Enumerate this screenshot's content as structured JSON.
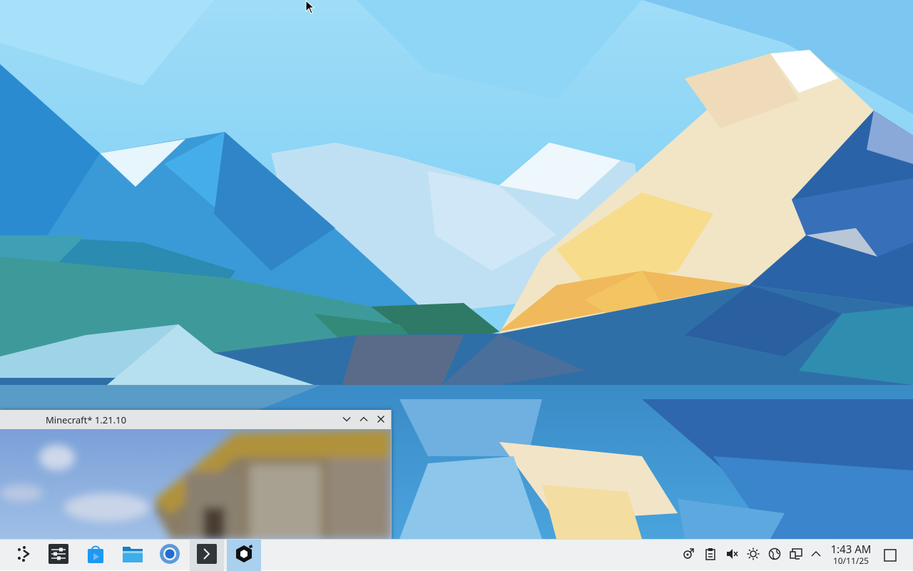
{
  "window": {
    "title": "Minecraft* 1.21.10",
    "minimize_icon": "chevron-down-icon",
    "maximize_icon": "chevron-up-icon",
    "close_icon": "close-icon"
  },
  "taskbar": {
    "launcher_icon": "application-launcher-icon",
    "pinned": [
      {
        "name": "system-settings",
        "icon": "settings-sliders-icon"
      },
      {
        "name": "discover",
        "icon": "store-bag-icon"
      },
      {
        "name": "dolphin",
        "icon": "folder-icon"
      },
      {
        "name": "chromium",
        "icon": "chromium-icon"
      },
      {
        "name": "konsole",
        "icon": "terminal-icon"
      },
      {
        "name": "minecraft",
        "icon": "minecraft-launcher-icon"
      }
    ],
    "tray": [
      "kde-connect-icon",
      "clipboard-icon",
      "volume-muted-icon",
      "brightness-icon",
      "network-globe-icon",
      "display-icon",
      "expand-tray-icon"
    ],
    "clock": {
      "time": "1:43 AM",
      "date": "10/11/25"
    }
  },
  "colors": {
    "taskbar_bg": "#eef0f1",
    "active_task": "#a9d0ee",
    "accent": "#3daee9"
  }
}
